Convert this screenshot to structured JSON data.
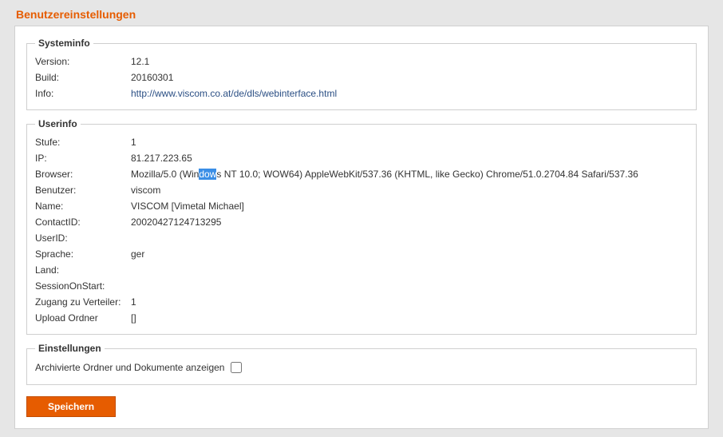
{
  "pageTitle": "Benutzereinstellungen",
  "systeminfo": {
    "legend": "Systeminfo",
    "versionLabel": "Version:",
    "versionValue": "12.1",
    "buildLabel": "Build:",
    "buildValue": "20160301",
    "infoLabel": "Info:",
    "infoValue": "http://www.viscom.co.at/de/dls/webinterface.html"
  },
  "userinfo": {
    "legend": "Userinfo",
    "stufeLabel": "Stufe:",
    "stufeValue": "1",
    "ipLabel": "IP:",
    "ipValue": "81.217.223.65",
    "browserLabel": "Browser:",
    "browserPrefix": "Mozilla/5.0 (Win",
    "browserHighlight": "dow",
    "browserSuffix": "s NT 10.0; WOW64) AppleWebKit/537.36 (KHTML, like Gecko) Chrome/51.0.2704.84 Safari/537.36",
    "benutzerLabel": "Benutzer:",
    "benutzerValue": "viscom",
    "nameLabel": "Name:",
    "nameValue": "VISCOM [Vimetal Michael]",
    "contactIdLabel": "ContactID:",
    "contactIdValue": "20020427124713295",
    "userIdLabel": "UserID:",
    "userIdValue": "",
    "spracheLabel": "Sprache:",
    "spracheValue": "ger",
    "landLabel": "Land:",
    "landValue": "",
    "sessionOnStartLabel": "SessionOnStart:",
    "sessionOnStartValue": "",
    "zugangLabel": "Zugang zu Verteiler:",
    "zugangValue": "1",
    "uploadOrdnerLabel": "Upload Ordner",
    "uploadOrdnerValue": "[]"
  },
  "einstellungen": {
    "legend": "Einstellungen",
    "archiveLabel": "Archivierte Ordner und Dokumente anzeigen"
  },
  "buttons": {
    "save": "Speichern"
  }
}
